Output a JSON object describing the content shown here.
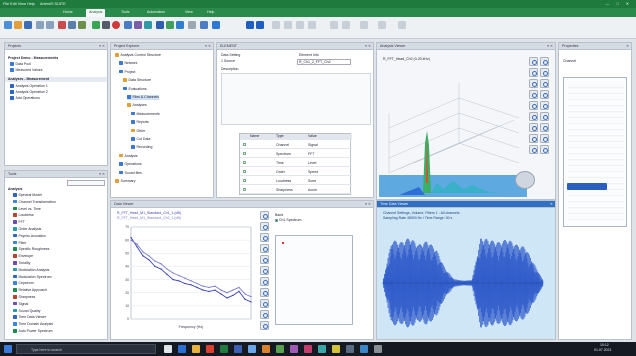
{
  "window": {
    "title": "ArtemiS SUITE",
    "menu": "File  Edit  View  Help"
  },
  "ribbon": {
    "tabs": [
      "Home",
      "Analysis",
      "Tools",
      "Automation",
      "View",
      "Help"
    ],
    "active": 1
  },
  "toolbar": {
    "icons": [
      "new-icon",
      "open-icon",
      "save-icon",
      "undo-icon",
      "redo-icon",
      "cut-icon",
      "copy-icon",
      "paste-icon",
      "play-icon",
      "stop-icon",
      "record-icon",
      "zoom-icon",
      "cursor-icon",
      "measure-icon",
      "filter-icon",
      "export-icon",
      "report-icon",
      "settings-icon"
    ]
  },
  "panels": {
    "projects": {
      "title": "Projects",
      "items": [
        "Project Demo - Measurements",
        "Data Pool",
        "Measured Values"
      ],
      "sub_title": "Analyses - Measurement",
      "sub_items": [
        "Analysis Operation 1",
        "Analysis Operation 2",
        "Add Operations"
      ]
    },
    "tools": {
      "title": "Tools",
      "section": "Analysis",
      "items": [
        "Spectral Model",
        "Channel Transformation",
        "Level vs. Time",
        "Loudness",
        "FFT",
        "Order Analysis",
        "Psycho Acoustics",
        "Filter",
        "Specific Roughness",
        "Envelope",
        "Tonality",
        "Modulation Analysis",
        "Modulation Spectrum",
        "Cepstrum",
        "Relative Approach",
        "Sharpness",
        "Signal",
        "Sound Quality",
        "Time Data Viewer",
        "Time Domain Analysis",
        "Auto Power Spectrum"
      ]
    },
    "explorer": {
      "title": "Project Explorer",
      "tree": [
        "Analysis Control Structure",
        "Network",
        "Project",
        "Data Structure",
        "Evaluations",
        "Files & Channels",
        "Analyses",
        "Measurements",
        "Reports",
        "Other",
        "Cut Data",
        "Recording",
        "Analysis",
        "Operations",
        "Sound files",
        "Summary"
      ]
    },
    "properties": {
      "title": "ELEMENT",
      "label1": "Data Setting",
      "label2": "Element Info",
      "field1": "1 Source",
      "value1": "R_Ch1_2_FFT_Ch2",
      "field2": "Description",
      "table_headers": [
        "Name",
        "Type",
        "Value"
      ],
      "table_rows": [
        [
          "",
          "Channel",
          "Signal"
        ],
        [
          "",
          "Spectrum",
          "FFT"
        ],
        [
          "",
          "Time",
          "Level"
        ],
        [
          "",
          "Order",
          "Speed"
        ],
        [
          "",
          "Loudness",
          "Sone"
        ],
        [
          "",
          "Sharpness",
          "Acum"
        ]
      ]
    },
    "threed": {
      "title": "Analysis Viewer",
      "caption": "R_FFT_Head_Ch2 (0-20 kHz)"
    },
    "twod": {
      "title": "Data Viewer",
      "legend": [
        "R_FFT_Head_M1_Standard_Ch1_1 (dB)",
        "R_FFT_Head_M1_Standard_Ch2_1 (dB)"
      ],
      "yticks": [
        "70",
        "60",
        "50",
        "40",
        "30",
        "20",
        "10",
        "0"
      ],
      "xlabel": "Frequency (Hz)",
      "side_label": "Band",
      "side_option": "Ch1 Spectrum"
    },
    "time": {
      "title": "Time Data Viewer",
      "legend": [
        "Channel Settings, Volume, Filters 1 - All channels",
        "Sampling Rate 48000 Hz / Time Range: 30 s"
      ]
    },
    "right": {
      "title": "Properties",
      "label": "Channel"
    }
  },
  "taskbar": {
    "search": "Type here to search",
    "time": "10:12",
    "date": "01.07.2021"
  },
  "chart_data": [
    {
      "type": "line",
      "title": "R_FFT_Head_Ch1_Ch2",
      "xlabel": "Frequency (Hz)",
      "ylabel": "dB",
      "ylim": [
        0,
        70
      ],
      "series": [
        {
          "name": "R_FFT_Head_M1_Standard_Ch1_1 (dB)",
          "color": "#3a44b0",
          "values": [
            62,
            55,
            48,
            45,
            40,
            38,
            34,
            30,
            29,
            27,
            26,
            24,
            22,
            21,
            22,
            19,
            16,
            18,
            21,
            15,
            13
          ]
        },
        {
          "name": "R_FFT_Head_M1_Standard_Ch2_1 (dB)",
          "color": "#7a7fd0",
          "values": [
            60,
            57,
            51,
            48,
            44,
            42,
            38,
            35,
            33,
            31,
            29,
            27,
            25,
            24,
            25,
            22,
            20,
            22,
            24,
            19,
            17
          ]
        }
      ]
    },
    {
      "type": "area",
      "title": "Time signal",
      "series": [
        {
          "name": "Ch1",
          "color": "#2a57c8",
          "values": [
            0.05,
            0.9,
            0.85,
            0.95,
            0.8,
            0.88,
            0.7,
            0.3,
            0.08,
            0.05,
            0.06,
            0.95,
            0.9,
            0.85,
            0.92,
            0.8,
            0.75,
            0.4,
            0.06
          ]
        }
      ]
    }
  ]
}
